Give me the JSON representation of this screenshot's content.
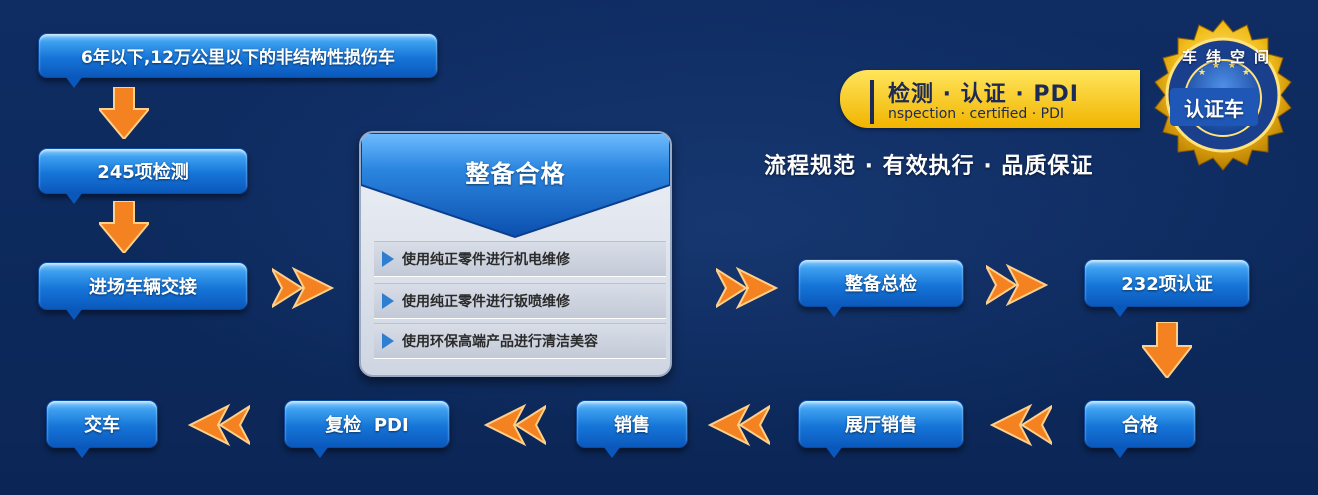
{
  "flow": {
    "start": "6年以下,12万公里以下的非结构性损伤车",
    "step_inspect": "245项检测",
    "step_handover": "进场车辆交接",
    "step_final_check": "整备总检",
    "step_certify": "232项认证",
    "step_pass": "合格",
    "step_showroom": "展厅销售",
    "step_sale": "销售",
    "step_recheck": "复检  PDI",
    "step_delivery": "交车"
  },
  "panel": {
    "title": "整备合格",
    "items": [
      "使用纯正零件进行机电维修",
      "使用纯正零件进行钣喷维修",
      "使用环保高端产品进行清洁美容"
    ]
  },
  "banner": {
    "cn": "检测 · 认证 · PDI",
    "en": "nspection · certified · PDI"
  },
  "slogan": "流程规范 · 有效执行 · 品质保证",
  "seal": {
    "top": "车纬空间",
    "main": "认证车"
  }
}
